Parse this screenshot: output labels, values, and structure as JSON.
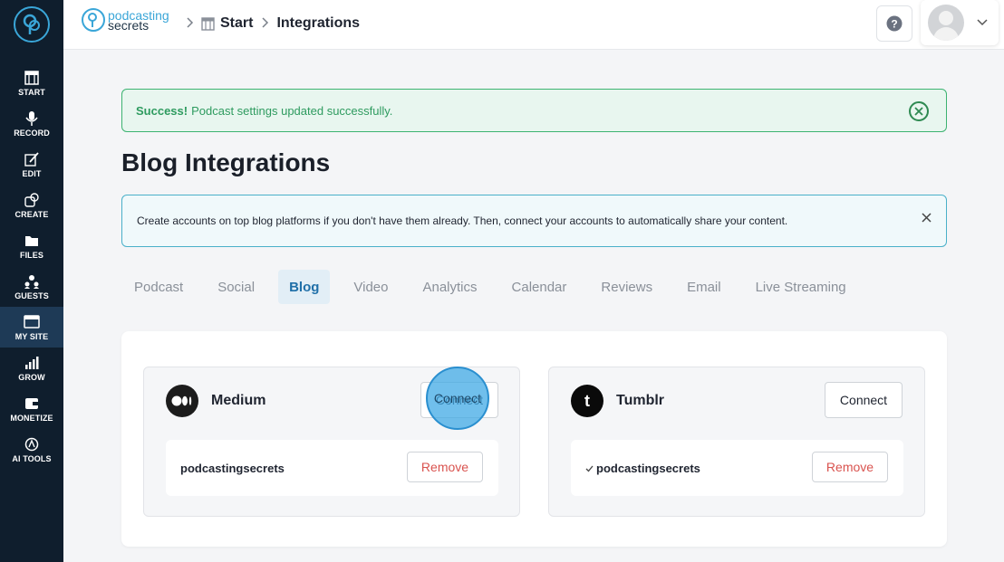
{
  "sidebar": {
    "items": [
      {
        "label": "START",
        "icon": "start-icon"
      },
      {
        "label": "RECORD",
        "icon": "microphone-icon"
      },
      {
        "label": "EDIT",
        "icon": "edit-icon"
      },
      {
        "label": "CREATE",
        "icon": "create-icon"
      },
      {
        "label": "FILES",
        "icon": "folder-icon"
      },
      {
        "label": "GUESTS",
        "icon": "guests-icon"
      },
      {
        "label": "MY SITE",
        "icon": "site-icon",
        "active": true
      },
      {
        "label": "GROW",
        "icon": "chart-icon"
      },
      {
        "label": "MONETIZE",
        "icon": "money-icon"
      },
      {
        "label": "AI TOOLS",
        "icon": "ai-icon"
      }
    ]
  },
  "header": {
    "brand_line1": "podcasting",
    "brand_line2": "secrets",
    "breadcrumb": {
      "home": "Start",
      "current": "Integrations"
    }
  },
  "alerts": {
    "success_strong": "Success!",
    "success_text": "Podcast settings updated successfully.",
    "info_text": "Create accounts on top blog platforms if you don't have them already. Then, connect your accounts to automatically share your content."
  },
  "page": {
    "title": "Blog Integrations"
  },
  "tabs": [
    {
      "label": "Podcast"
    },
    {
      "label": "Social"
    },
    {
      "label": "Blog",
      "active": true
    },
    {
      "label": "Video"
    },
    {
      "label": "Analytics"
    },
    {
      "label": "Calendar"
    },
    {
      "label": "Reviews"
    },
    {
      "label": "Email"
    },
    {
      "label": "Live Streaming"
    }
  ],
  "integrations": {
    "medium": {
      "name": "Medium",
      "connect_label": "Connect",
      "account": "podcastingsecrets",
      "remove_label": "Remove"
    },
    "tumblr": {
      "name": "Tumblr",
      "connect_label": "Connect",
      "account": "podcastingsecrets",
      "remove_label": "Remove"
    }
  },
  "colors": {
    "sidebar_bg": "#0f1e2d",
    "accent": "#3aa6d8",
    "success": "#3cb371",
    "info_border": "#49b0c9",
    "remove_text": "#d9534f"
  }
}
